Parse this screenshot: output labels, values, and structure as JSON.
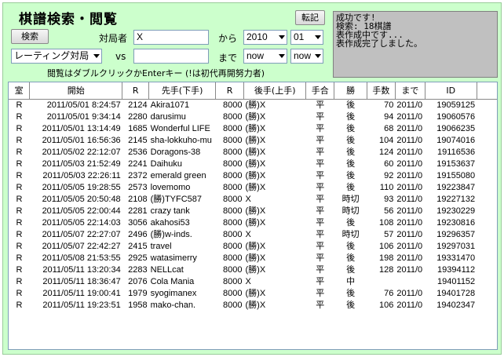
{
  "title": "棋譜検索・閲覧",
  "buttons": {
    "search": "検索",
    "transcribe": "転記"
  },
  "form": {
    "player_label": "対局者",
    "player_value": "X",
    "from_label": "から",
    "from_year": "2010",
    "from_month": "01",
    "rating_select": "レーティング対局",
    "vs_label": "vs",
    "opponent_value": "",
    "to_label": "まで",
    "to_year": "now",
    "to_month": "now"
  },
  "status_lines": [
    "成功です!",
    "検索: 18棋譜",
    "表作成中です...",
    "表作成完了しました。"
  ],
  "hint": "閲覧はダブルクリックかEnterキー (!は初代再開努力者)",
  "table": {
    "columns": [
      "室",
      "開始",
      "R",
      "先手(下手)",
      "R",
      "後手(上手)",
      "手合",
      "勝",
      "手数",
      "まで",
      "ID"
    ],
    "rows": [
      [
        "R",
        "2011/05/01 8:24:57",
        "2124",
        "Akira1071",
        "8000",
        "(勝)X",
        "平",
        "後",
        "70",
        "2011/0",
        "19059125"
      ],
      [
        "R",
        "2011/05/01 9:34:14",
        "2280",
        "darusimu",
        "8000",
        "(勝)X",
        "平",
        "後",
        "94",
        "2011/0",
        "19060576"
      ],
      [
        "R",
        "2011/05/01 13:14:49",
        "1685",
        "Wonderful LIFE",
        "8000",
        "(勝)X",
        "平",
        "後",
        "68",
        "2011/0",
        "19066235"
      ],
      [
        "R",
        "2011/05/01 16:56:36",
        "2145",
        "sha-lokkuho-mu",
        "8000",
        "(勝)X",
        "平",
        "後",
        "104",
        "2011/0",
        "19074016"
      ],
      [
        "R",
        "2011/05/02 22:12:07",
        "2536",
        "Doragons-38",
        "8000",
        "(勝)X",
        "平",
        "後",
        "124",
        "2011/0",
        "19116536"
      ],
      [
        "R",
        "2011/05/03 21:52:49",
        "2241",
        "Daihuku",
        "8000",
        "(勝)X",
        "平",
        "後",
        "60",
        "2011/0",
        "19153637"
      ],
      [
        "R",
        "2011/05/03 22:26:11",
        "2372",
        "emerald green",
        "8000",
        "(勝)X",
        "平",
        "後",
        "92",
        "2011/0",
        "19155080"
      ],
      [
        "R",
        "2011/05/05 19:28:55",
        "2573",
        "lovemomo",
        "8000",
        "(勝)X",
        "平",
        "後",
        "110",
        "2011/0",
        "19223847"
      ],
      [
        "R",
        "2011/05/05 20:50:48",
        "2108",
        "(勝)TYFC587",
        "8000",
        "X",
        "平",
        "時切",
        "93",
        "2011/0",
        "19227132"
      ],
      [
        "R",
        "2011/05/05 22:00:44",
        "2281",
        "crazy tank",
        "8000",
        "(勝)X",
        "平",
        "時切",
        "56",
        "2011/0",
        "19230229"
      ],
      [
        "R",
        "2011/05/05 22:14:03",
        "3056",
        "akahosi53",
        "8000",
        "(勝)X",
        "平",
        "後",
        "108",
        "2011/0",
        "19230816"
      ],
      [
        "R",
        "2011/05/07 22:27:07",
        "2496",
        "(勝)w-inds.",
        "8000",
        "X",
        "平",
        "時切",
        "57",
        "2011/0",
        "19296357"
      ],
      [
        "R",
        "2011/05/07 22:42:27",
        "2415",
        "travel",
        "8000",
        "(勝)X",
        "平",
        "後",
        "106",
        "2011/0",
        "19297031"
      ],
      [
        "R",
        "2011/05/08 21:53:55",
        "2925",
        "watasimerry",
        "8000",
        "(勝)X",
        "平",
        "後",
        "198",
        "2011/0",
        "19331470"
      ],
      [
        "R",
        "2011/05/11 13:20:34",
        "2283",
        "NELLcat",
        "8000",
        "(勝)X",
        "平",
        "後",
        "128",
        "2011/0",
        "19394112"
      ],
      [
        "R",
        "2011/05/11 18:36:47",
        "2076",
        "Cola Mania",
        "8000",
        "X",
        "平",
        "中",
        "",
        "",
        "19401152"
      ],
      [
        "R",
        "2011/05/11 19:00:41",
        "1979",
        "syogimanex",
        "8000",
        "(勝)X",
        "平",
        "後",
        "76",
        "2011/0",
        "19401728"
      ],
      [
        "R",
        "2011/05/11 19:23:51",
        "1958",
        "mako-chan.",
        "8000",
        "(勝)X",
        "平",
        "後",
        "106",
        "2011/0",
        "19402347"
      ]
    ]
  },
  "colors": {
    "panel_bg": "#ccffcc",
    "status_bg": "#c0c0c0"
  }
}
